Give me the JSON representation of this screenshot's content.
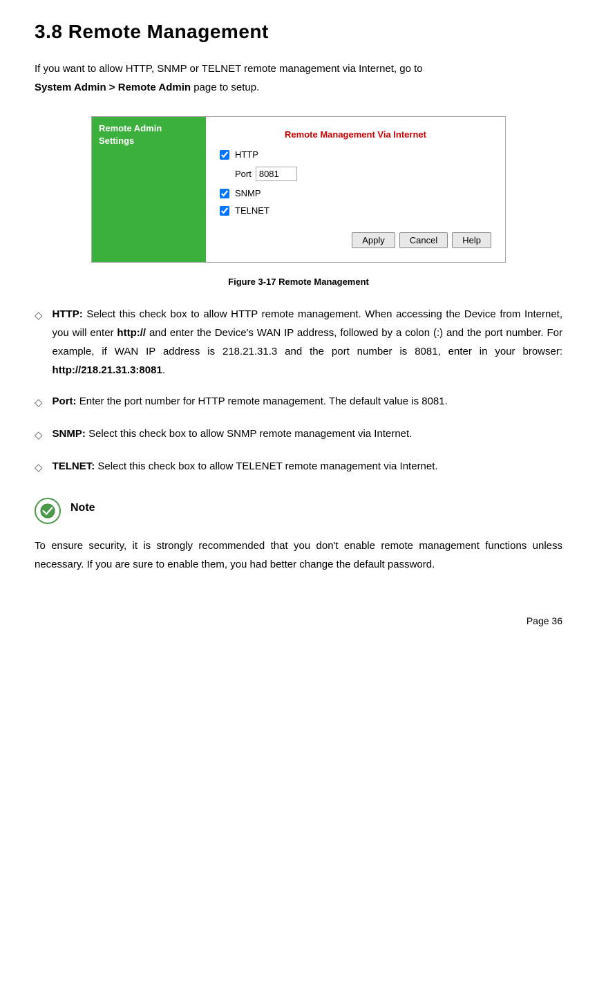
{
  "page": {
    "title": "3.8    Remote Management",
    "page_number": "Page  36"
  },
  "intro": {
    "text1": "If you want to allow HTTP, SNMP or TELNET remote management via Internet, go to",
    "text2_bold": "System Admin > Remote Admin",
    "text2_rest": " page to setup."
  },
  "router_ui": {
    "sidebar_label": "Remote Admin Settings",
    "panel_title": "Remote Management Via Internet",
    "http_label": "HTTP",
    "http_checked": true,
    "port_label": "Port",
    "port_value": "8081",
    "snmp_label": "SNMP",
    "snmp_checked": true,
    "telnet_label": "TELNET",
    "telnet_checked": true,
    "apply_label": "Apply",
    "cancel_label": "Cancel",
    "help_label": "Help"
  },
  "figure_caption": "Figure 3-17 Remote Management",
  "descriptions": [
    {
      "term": "HTTP:",
      "text": " Select this check box to allow HTTP remote management. When accessing the Device from Internet, you will enter http:// and enter the Device's WAN IP address, followed by a colon (:) and the port number. For example, if WAN IP address is 218.21.31.3 and the port number is 8081, enter in your browser: http://218.21.31.3:8081."
    },
    {
      "term": "Port:",
      "text": " Enter the port number for HTTP remote management. The default value is 8081."
    },
    {
      "term": "SNMP:",
      "text": " Select this check box to allow SNMP remote management via Internet."
    },
    {
      "term": "TELNET:",
      "text": " Select this check box to allow TELENET remote management via Internet."
    }
  ],
  "note": {
    "title": "Note",
    "text": "To  ensure security,  it  is  strongly  recommended  that  you  don't  enable  remote management functions unless necessary. If you are sure to enable them, you had better change the default password."
  }
}
